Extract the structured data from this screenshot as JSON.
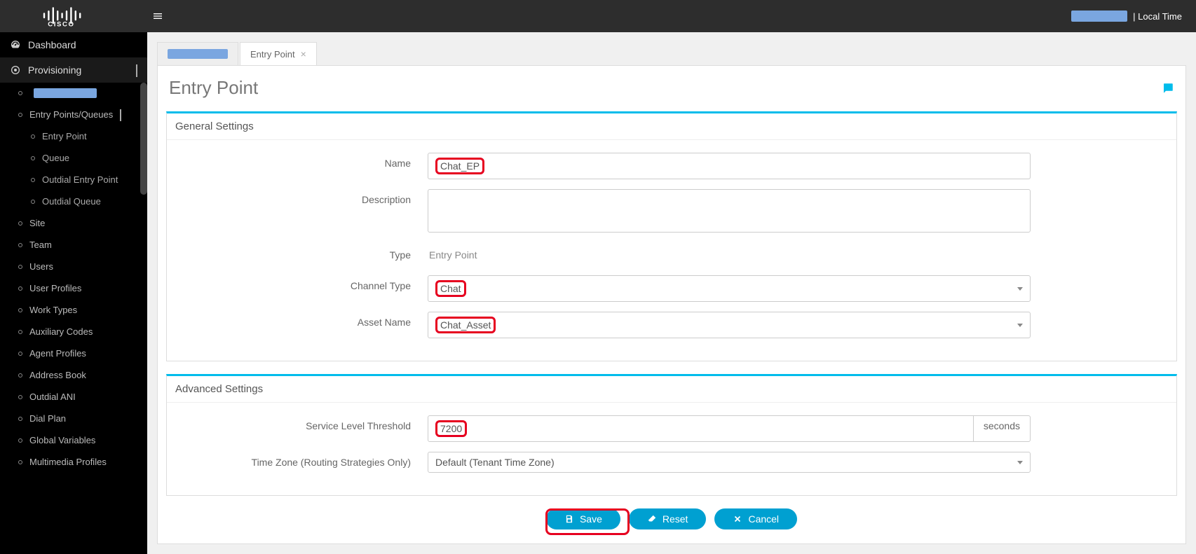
{
  "top": {
    "local_time_label": "| Local Time"
  },
  "sidebar": {
    "dashboard": "Dashboard",
    "provisioning": "Provisioning",
    "epq": "Entry Points/Queues",
    "epq_children": [
      "Entry Point",
      "Queue",
      "Outdial Entry Point",
      "Outdial Queue"
    ],
    "rest": [
      "Site",
      "Team",
      "Users",
      "User Profiles",
      "Work Types",
      "Auxiliary Codes",
      "Agent Profiles",
      "Address Book",
      "Outdial ANI",
      "Dial Plan",
      "Global Variables",
      "Multimedia Profiles"
    ]
  },
  "tabs": {
    "active": "Entry Point"
  },
  "page": {
    "title": "Entry Point"
  },
  "general": {
    "heading": "General Settings",
    "name_label": "Name",
    "name_value": "Chat_EP",
    "desc_label": "Description",
    "desc_value": "",
    "type_label": "Type",
    "type_value": "Entry Point",
    "channel_type_label": "Channel Type",
    "channel_type_value": "Chat",
    "asset_name_label": "Asset Name",
    "asset_name_value": "Chat_Asset"
  },
  "advanced": {
    "heading": "Advanced Settings",
    "slt_label": "Service Level Threshold",
    "slt_value": "7200",
    "slt_unit": "seconds",
    "tz_label": "Time Zone (Routing Strategies Only)",
    "tz_value": "Default (Tenant Time Zone)"
  },
  "buttons": {
    "save": "Save",
    "reset": "Reset",
    "cancel": "Cancel"
  }
}
